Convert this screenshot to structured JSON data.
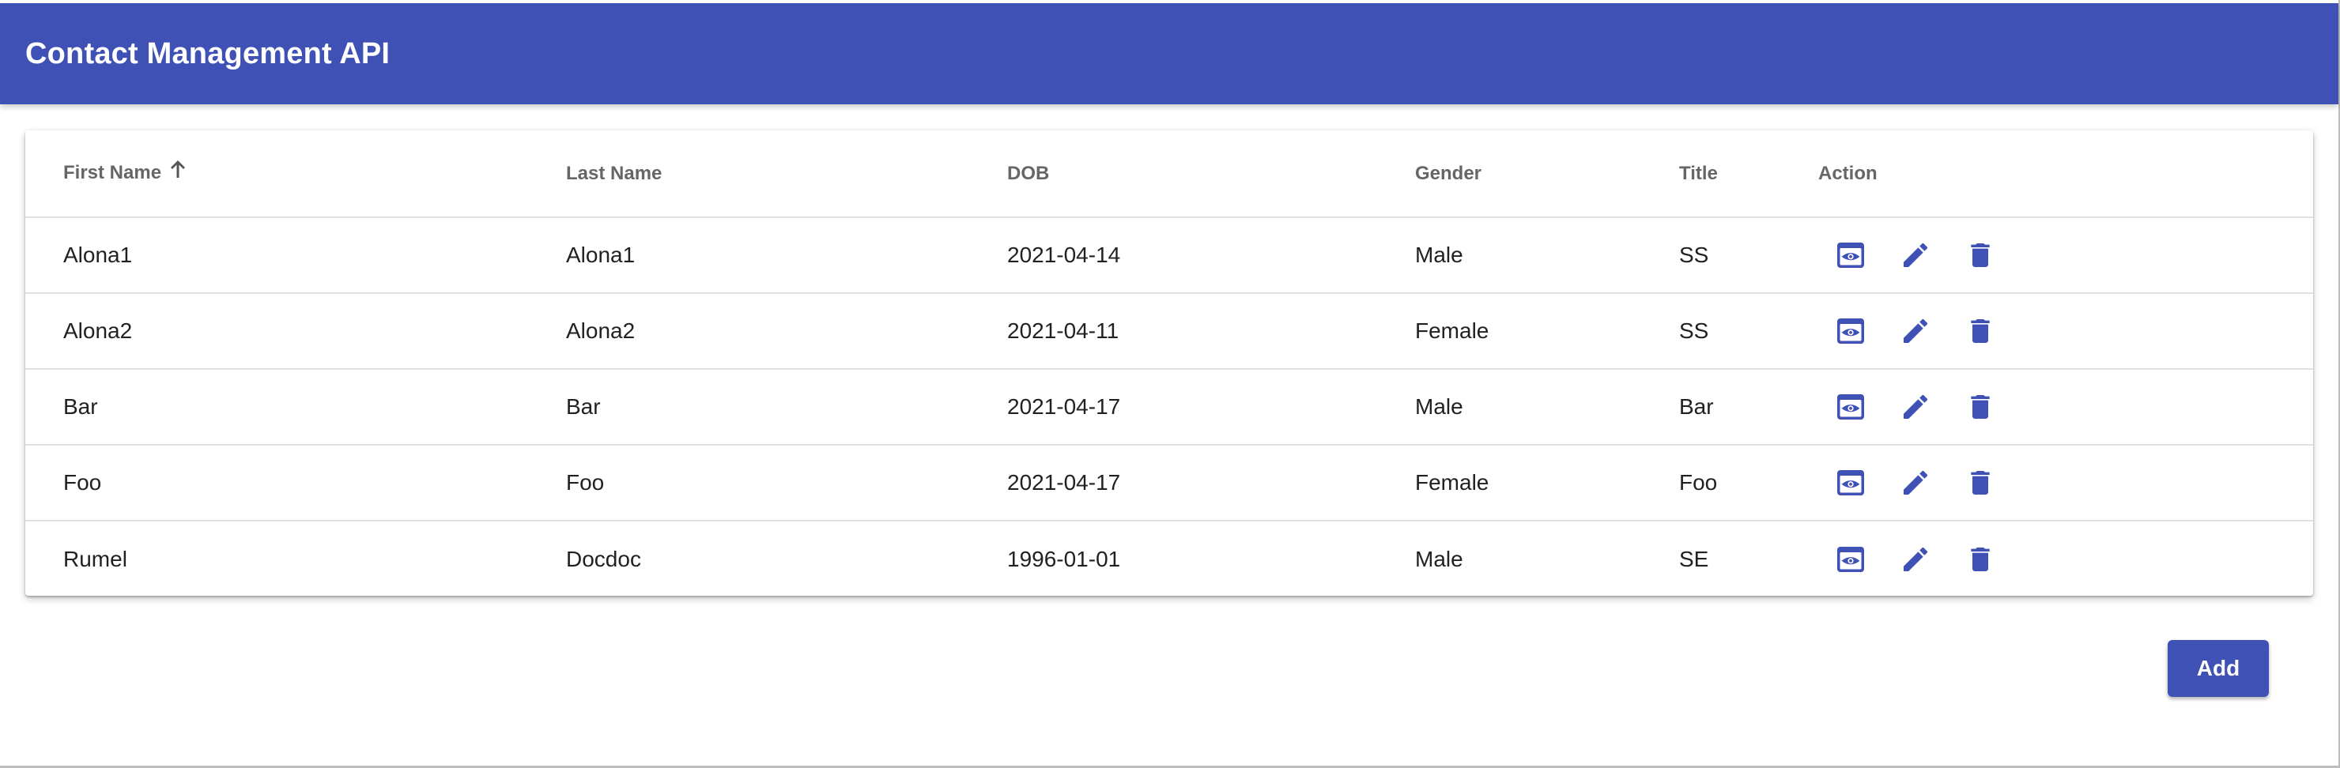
{
  "app": {
    "title": "Contact Management API",
    "primary_color": "#3f51b5"
  },
  "table": {
    "columns": [
      {
        "label": "First Name",
        "sorted": "ascending"
      },
      {
        "label": "Last Name"
      },
      {
        "label": "DOB"
      },
      {
        "label": "Gender"
      },
      {
        "label": "Title"
      },
      {
        "label": "Action"
      }
    ],
    "rows": [
      {
        "first_name": "Alona1",
        "last_name": "Alona1",
        "dob": "2021-04-14",
        "gender": "Male",
        "title": "SS"
      },
      {
        "first_name": "Alona2",
        "last_name": "Alona2",
        "dob": "2021-04-11",
        "gender": "Female",
        "title": "SS"
      },
      {
        "first_name": "Bar",
        "last_name": "Bar",
        "dob": "2021-04-17",
        "gender": "Male",
        "title": "Bar"
      },
      {
        "first_name": "Foo",
        "last_name": "Foo",
        "dob": "2021-04-17",
        "gender": "Female",
        "title": "Foo"
      },
      {
        "first_name": "Rumel",
        "last_name": "Docdoc",
        "dob": "1996-01-01",
        "gender": "Male",
        "title": "SE"
      }
    ],
    "row_actions": [
      "view-icon",
      "edit-icon",
      "delete-icon"
    ]
  },
  "footer": {
    "add_label": "Add"
  }
}
